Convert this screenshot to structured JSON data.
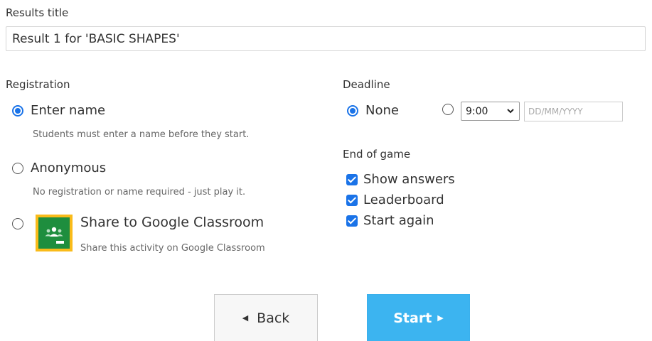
{
  "results_title": {
    "label": "Results title",
    "value": "Result 1 for 'BASIC SHAPES'"
  },
  "registration": {
    "heading": "Registration",
    "options": [
      {
        "label": "Enter name",
        "hint": "Students must enter a name before they start.",
        "checked": true
      },
      {
        "label": "Anonymous",
        "hint": "No registration or name required - just play it.",
        "checked": false
      },
      {
        "label": "Share to Google Classroom",
        "hint": "Share this activity on Google Classroom",
        "checked": false,
        "icon": "google-classroom-icon"
      }
    ]
  },
  "deadline": {
    "heading": "Deadline",
    "none_label": "None",
    "none_checked": true,
    "time_value": "9:00",
    "date_placeholder": "DD/MM/YYYY"
  },
  "end_of_game": {
    "heading": "End of game",
    "options": [
      {
        "label": "Show answers",
        "checked": true
      },
      {
        "label": "Leaderboard",
        "checked": true
      },
      {
        "label": "Start again",
        "checked": true
      }
    ]
  },
  "buttons": {
    "back_label": "Back",
    "back_icon": "triangle-left-icon",
    "start_label": "Start",
    "start_icon": "triangle-right-icon"
  },
  "colors": {
    "accent": "#1a73e8",
    "start_button": "#3cb4f0"
  }
}
